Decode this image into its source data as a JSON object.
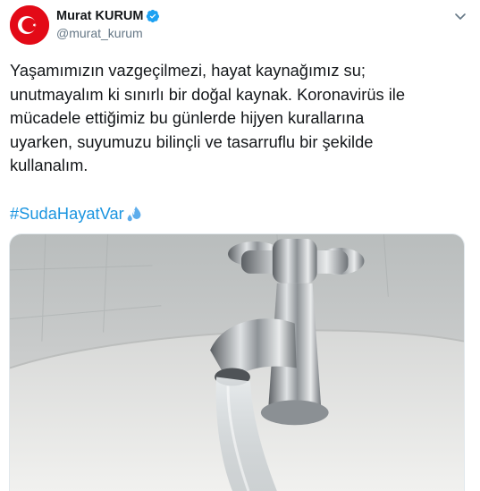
{
  "tweet": {
    "display_name": "Murat KURUM",
    "handle": "@murat_kurum",
    "text": "Yaşamımızın vazgeçilmezi, hayat kaynağımız su;\nunutmayalım ki sınırlı bir doğal kaynak. Koronavirüs ile\nmücadele ettiğimiz bu günlerde hijyen kurallarına\nuyarken, suyumuzu bilinçli ve tasarruflu bir şekilde\nkullanalım.",
    "hashtag": "#SudaHayatVar"
  },
  "icons": {
    "avatar": "turkish-flag-avatar",
    "verified": "verified-badge-icon",
    "menu": "chevron-down-icon",
    "emoji": "sweat-droplets-emoji"
  },
  "colors": {
    "link": "#1b95e0",
    "verified": "#1da1f2",
    "secondary_text": "#657786"
  }
}
